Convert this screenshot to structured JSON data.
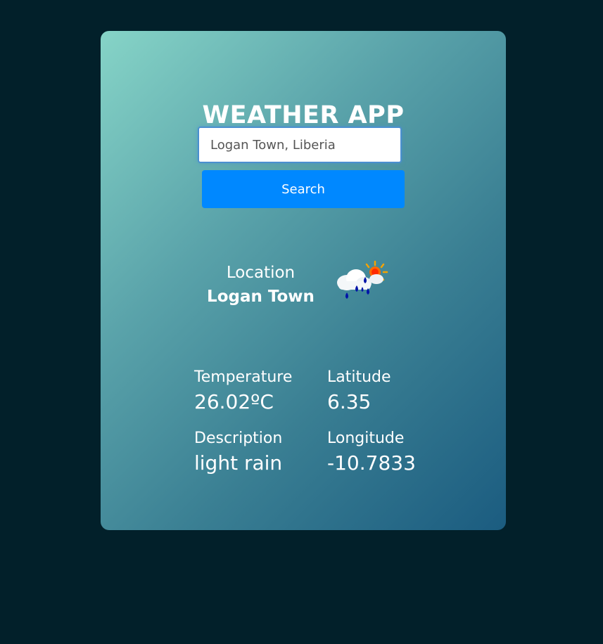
{
  "app": {
    "title": "WEATHER APP"
  },
  "search": {
    "value": "Logan Town, Liberia",
    "button_label": "Search"
  },
  "location": {
    "label": "Location",
    "value": "Logan Town",
    "icon": "cloud-rain-sun-icon"
  },
  "stats": {
    "temperature": {
      "label": "Temperature",
      "value": "26.02ºC"
    },
    "latitude": {
      "label": "Latitude",
      "value": "6.35"
    },
    "description": {
      "label": "Description",
      "value": "light rain"
    },
    "longitude": {
      "label": "Longitude",
      "value": "-10.7833"
    }
  },
  "colors": {
    "page_background": "#02202a",
    "button": "#0088ff",
    "gradient_start": "#86d4c7",
    "gradient_end": "#1b5c80"
  }
}
